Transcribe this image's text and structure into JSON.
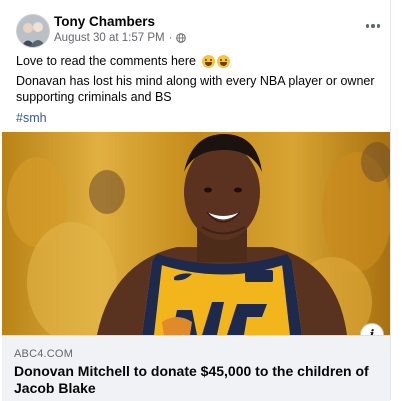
{
  "post": {
    "author": "Tony Chambers",
    "timestamp": "August 30 at 1:57 PM",
    "separator": "·",
    "privacy_icon": "globe-icon",
    "more_icon": "more-options-icon",
    "text_line1": "Love to read the comments here",
    "emojis": [
      "laughing-emoji",
      "laughing-emoji"
    ],
    "text_line2": "Donavan has lost his mind along with every NBA player or owner supporting criminals and BS",
    "hashtag": "#smh"
  },
  "link_preview": {
    "image_icon": "basketball-player-photo",
    "info_label": "i",
    "source": "ABC4.COM",
    "headline": "Donovan Mitchell to donate $45,000 to the children of Jacob Blake"
  },
  "colors": {
    "text": "#050505",
    "meta": "#65676b",
    "hashtag": "#385898",
    "jersey_yellow": "#f2b51b",
    "jersey_navy": "#1d2a4d"
  }
}
